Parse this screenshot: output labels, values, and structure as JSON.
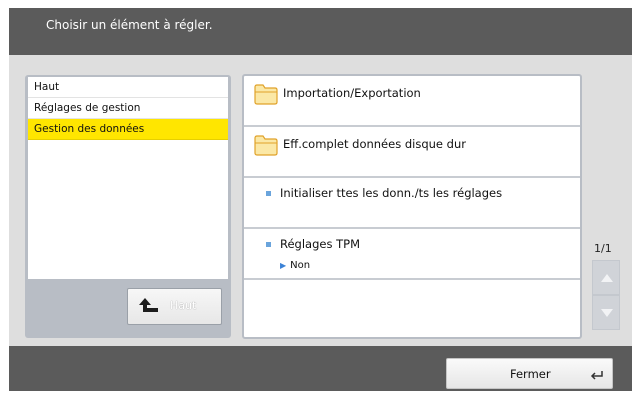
{
  "header": {
    "title": "Choisir un élément à régler."
  },
  "nav": {
    "items": [
      {
        "label": "Haut",
        "selected": false
      },
      {
        "label": "Réglages de gestion",
        "selected": false
      },
      {
        "label": "Gestion des données",
        "selected": true
      }
    ],
    "up_button": {
      "label": "Haut",
      "icon": "up-arrow-icon"
    }
  },
  "list": {
    "items": [
      {
        "label": "Importation/Exportation",
        "icon": "folder-icon"
      },
      {
        "label": "Eff.complet données disque dur",
        "icon": "folder-icon"
      },
      {
        "label": "Initialiser ttes les donn./ts les réglages",
        "icon": "bullet-icon"
      },
      {
        "label": "Réglages TPM",
        "icon": "bullet-icon",
        "value": "Non"
      }
    ]
  },
  "pager": {
    "indicator": "1/1",
    "up_icon": "scroll-up-icon",
    "down_icon": "scroll-down-icon"
  },
  "footer": {
    "close_label": "Fermer",
    "close_icon": "enter-icon"
  },
  "colors": {
    "header_bg": "#5b5b5b",
    "selection": "#ffe600",
    "panel_border": "#b8bdc5",
    "bullet": "#6aa4dc"
  }
}
